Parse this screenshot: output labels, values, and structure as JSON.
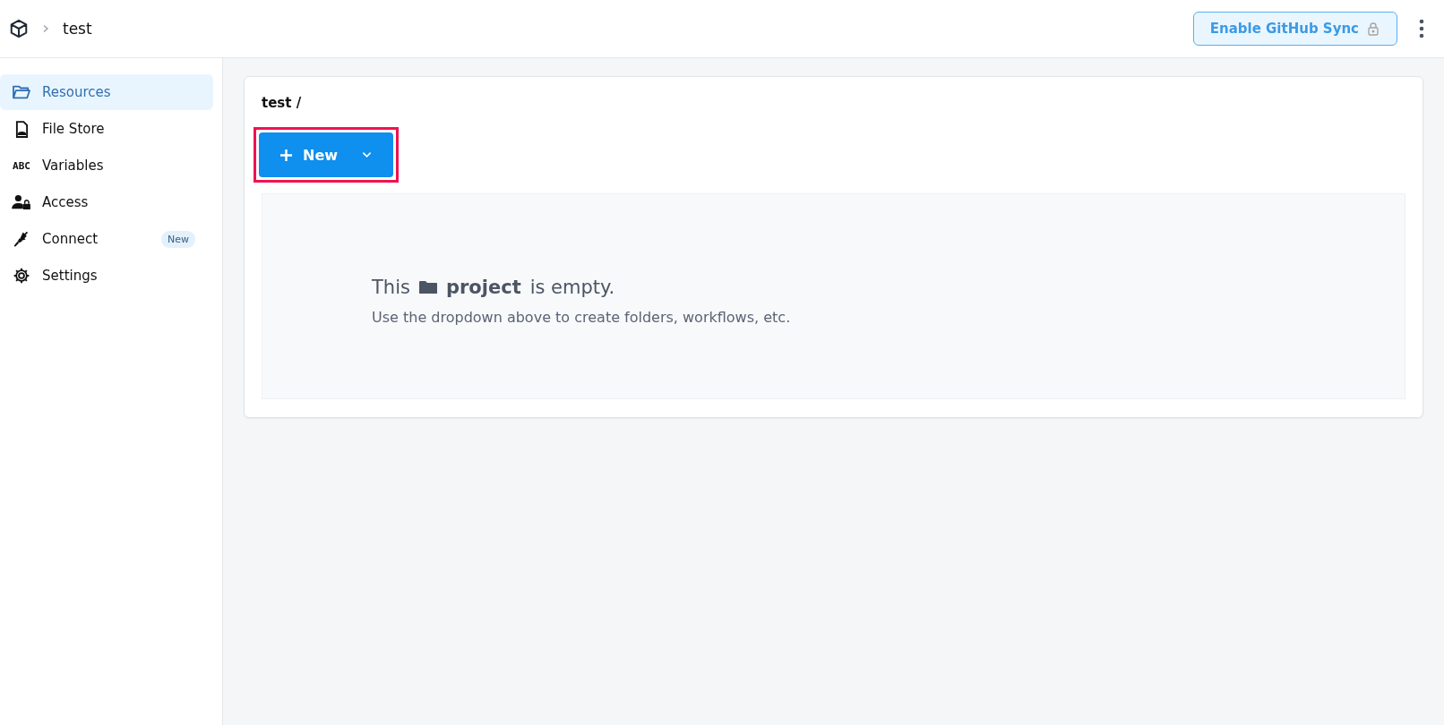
{
  "header": {
    "breadcrumb": "test",
    "sync_button": "Enable GitHub Sync"
  },
  "sidebar": {
    "items": [
      {
        "label": "Resources",
        "selected": true
      },
      {
        "label": "File Store",
        "selected": false
      },
      {
        "label": "Variables",
        "selected": false,
        "icon_text": "ABC"
      },
      {
        "label": "Access",
        "selected": false
      },
      {
        "label": "Connect",
        "selected": false,
        "badge": "New"
      },
      {
        "label": "Settings",
        "selected": false
      }
    ]
  },
  "content": {
    "path": "test /",
    "new_button": {
      "label": "New",
      "highlighted": true
    },
    "empty_state": {
      "title_before": "This",
      "title_bold": "project",
      "title_after": "is empty.",
      "hint": "Use the dropdown above to create folders, workflows, etc."
    }
  }
}
